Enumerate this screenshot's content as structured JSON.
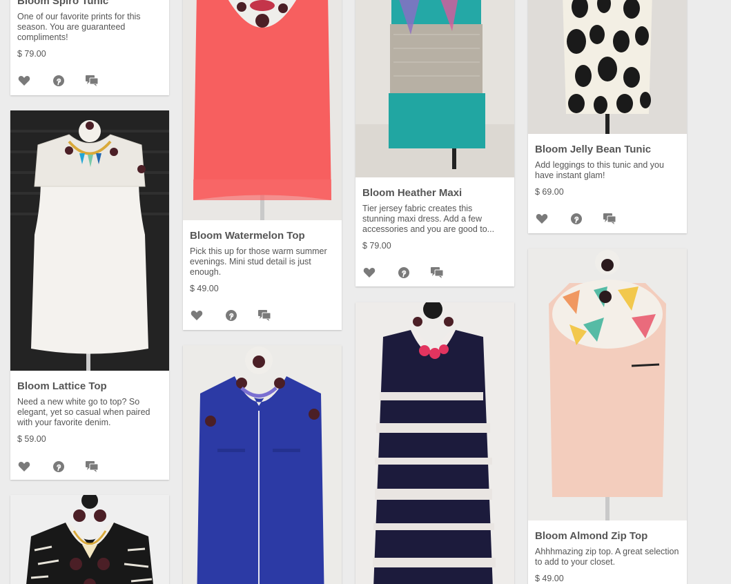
{
  "feed": {
    "items": [
      {
        "title": "Bloom Spiro Tunic",
        "description": "One of our favorite prints for this season. You are guaranteed compliments!",
        "price": "$ 79.00"
      },
      {
        "title": "Bloom Lattice Top",
        "description": "Need a new white go to top? So elegant, yet so casual when paired with your favorite denim.",
        "price": "$ 59.00"
      },
      {
        "title": "",
        "description": "",
        "price": ""
      },
      {
        "title": "Bloom Watermelon Top",
        "description": "Pick this up for those warm summer evenings. Mini stud detail is just enough.",
        "price": "$ 49.00"
      },
      {
        "title": "",
        "description": "",
        "price": ""
      },
      {
        "title": "Bloom Heather Maxi",
        "description": "Tier jersey fabric creates this stunning maxi dress. Add a few accessories and you are good to...",
        "price": "$ 79.00"
      },
      {
        "title": "",
        "description": "",
        "price": ""
      },
      {
        "title": "Bloom Jelly Bean Tunic",
        "description": "Add leggings to this tunic and you have instant glam!",
        "price": "$ 69.00"
      },
      {
        "title": "Bloom Almond Zip Top",
        "description": "Ahhhmazing zip top. A great selection to add to your closet.",
        "price": "$ 49.00"
      }
    ]
  },
  "icons": {
    "like": "heart-icon",
    "pin": "pinterest-icon",
    "comment": "comment-icon"
  },
  "colors": {
    "icon": "#7a7a7a",
    "title": "#555555",
    "background": "#ececec"
  }
}
